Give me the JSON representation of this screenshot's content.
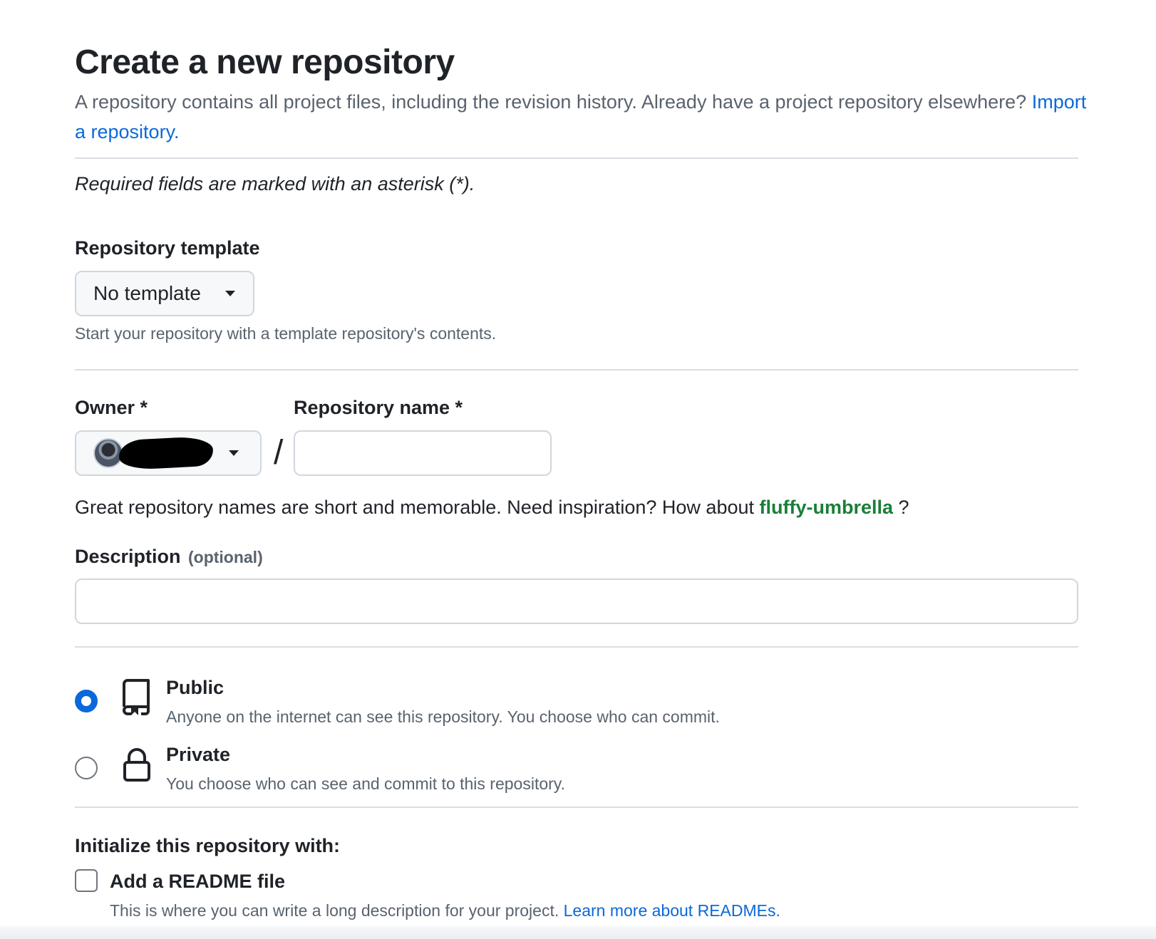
{
  "header": {
    "title": "Create a new repository",
    "subtitle_text": "A repository contains all project files, including the revision history. Already have a project repository elsewhere?",
    "import_link": "Import a repository."
  },
  "required_note": "Required fields are marked with an asterisk (*).",
  "template": {
    "label": "Repository template",
    "selected": "No template",
    "hint": "Start your repository with a template repository's contents."
  },
  "owner": {
    "label": "Owner *"
  },
  "separator": "/",
  "repo_name": {
    "label": "Repository name *",
    "value": ""
  },
  "suggestion": {
    "prefix": "Great repository names are short and memorable. Need inspiration? How about",
    "name": "fluffy-umbrella",
    "suffix": " ?"
  },
  "description": {
    "label": "Description",
    "optional": "(optional)",
    "value": ""
  },
  "visibility": {
    "selected": "public",
    "public": {
      "title": "Public",
      "desc": "Anyone on the internet can see this repository. You choose who can commit."
    },
    "private": {
      "title": "Private",
      "desc": "You choose who can see and commit to this repository."
    }
  },
  "initialize": {
    "label": "Initialize this repository with:",
    "readme_label": "Add a README file",
    "readme_checked": false,
    "readme_desc": "This is where you can write a long description for your project.",
    "readme_link": "Learn more about READMEs."
  },
  "colors": {
    "link": "#0969da",
    "suggestion_green": "#1a7f37",
    "radio_accent": "#0969da"
  }
}
